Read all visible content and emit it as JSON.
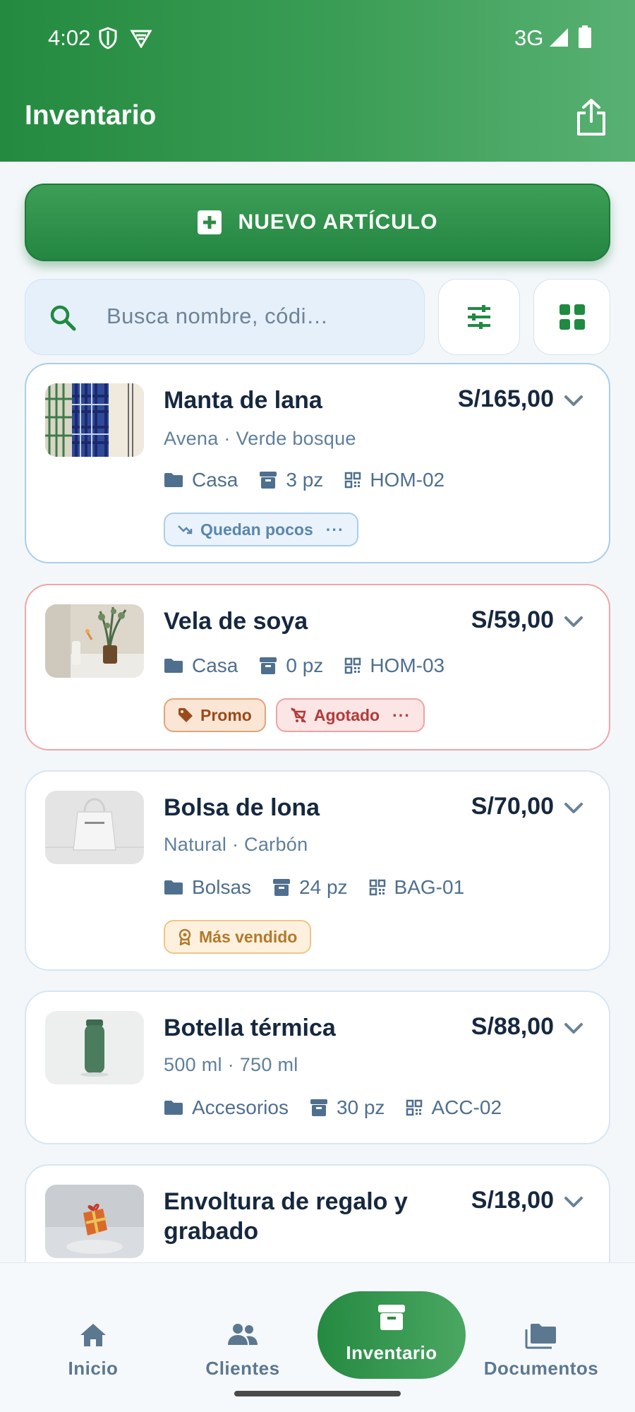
{
  "status_bar": {
    "time": "4:02",
    "network": "3G"
  },
  "header": {
    "title": "Inventario"
  },
  "actions": {
    "new_item_label": "NUEVO ARTÍCULO"
  },
  "search": {
    "placeholder": "Busca nombre, códi…"
  },
  "items": [
    {
      "name": "Manta de lana",
      "price": "S/165,00",
      "variant": "Avena · Verde bosque",
      "category": "Casa",
      "stock": "3 pz",
      "code": "HOM-02",
      "tags": [
        "Quedan pocos"
      ]
    },
    {
      "name": "Vela de soya",
      "price": "S/59,00",
      "category": "Casa",
      "stock": "0 pz",
      "code": "HOM-03",
      "tags": [
        "Promo",
        "Agotado"
      ]
    },
    {
      "name": "Bolsa de lona",
      "price": "S/70,00",
      "variant": "Natural · Carbón",
      "category": "Bolsas",
      "stock": "24 pz",
      "code": "BAG-01",
      "tags": [
        "Más vendido"
      ]
    },
    {
      "name": "Botella térmica",
      "price": "S/88,00",
      "variant": "500 ml · 750 ml",
      "category": "Accesorios",
      "stock": "30 pz",
      "code": "ACC-02"
    },
    {
      "name": "Envoltura de regalo y grabado",
      "price": "S/18,00"
    }
  ],
  "nav": [
    {
      "label": "Inicio",
      "icon": "home-icon"
    },
    {
      "label": "Clientes",
      "icon": "people-icon"
    },
    {
      "label": "Inventario",
      "icon": "archive-icon",
      "active": true
    },
    {
      "label": "Documentos",
      "icon": "folder-icon"
    }
  ],
  "colors": {
    "primary": "#2E8B47",
    "text_dark": "#16283F",
    "text_muted": "#5F7F9C",
    "soldout_border": "#F0A6A6"
  }
}
